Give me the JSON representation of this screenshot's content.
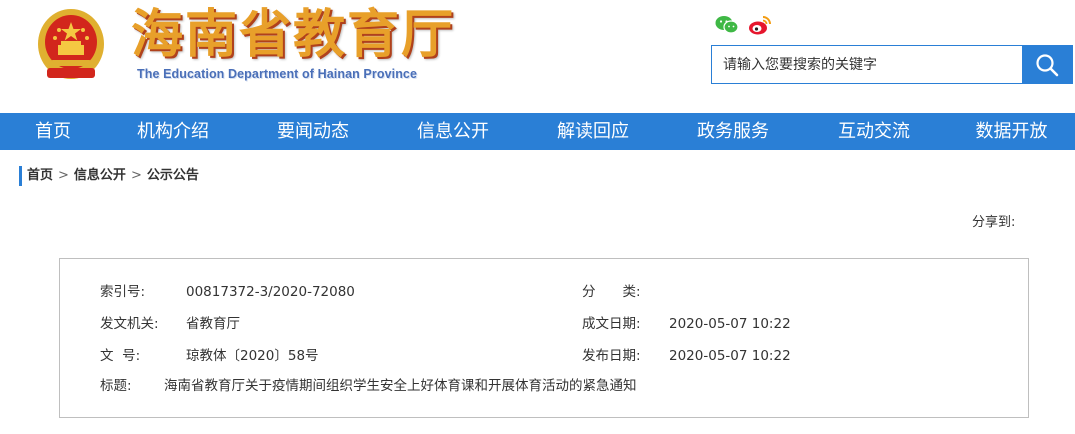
{
  "header": {
    "title": "海南省教育厅",
    "subtitle": "The Education Department of Hainan Province",
    "social": [
      "wechat-icon",
      "weibo-icon"
    ],
    "search": {
      "placeholder": "请输入您要搜索的关键字",
      "value": ""
    }
  },
  "nav": {
    "items": [
      {
        "label": "首页"
      },
      {
        "label": "机构介绍"
      },
      {
        "label": "要闻动态"
      },
      {
        "label": "信息公开"
      },
      {
        "label": "解读回应"
      },
      {
        "label": "政务服务"
      },
      {
        "label": "互动交流"
      },
      {
        "label": "数据开放"
      }
    ]
  },
  "breadcrumb": {
    "items": [
      "首页",
      "信息公开",
      "公示公告"
    ],
    "separator": ">"
  },
  "share_label": "分享到:",
  "info": {
    "index_label": "索引号:",
    "index_value": "00817372-3/2020-72080",
    "category_label": "分　　类:",
    "category_value": "",
    "issuer_label": "发文机关:",
    "issuer_value": "省教育厅",
    "created_label": "成文日期:",
    "created_value": "2020-05-07 10:22",
    "docno_label": "文  号:",
    "docno_value": "琼教体〔2020〕58号",
    "published_label": "发布日期:",
    "published_value": "2020-05-07 10:22",
    "title_label": "标题:",
    "title_value": "海南省教育厅关于疫情期间组织学生安全上好体育课和开展体育活动的紧急通知"
  },
  "colors": {
    "primary_blue": "#2a7fd6",
    "title_gold": "#e8a02a",
    "title_shadow": "#b0411c",
    "emblem_red": "#d2261c",
    "subtitle_blue": "#4a6fb8"
  }
}
